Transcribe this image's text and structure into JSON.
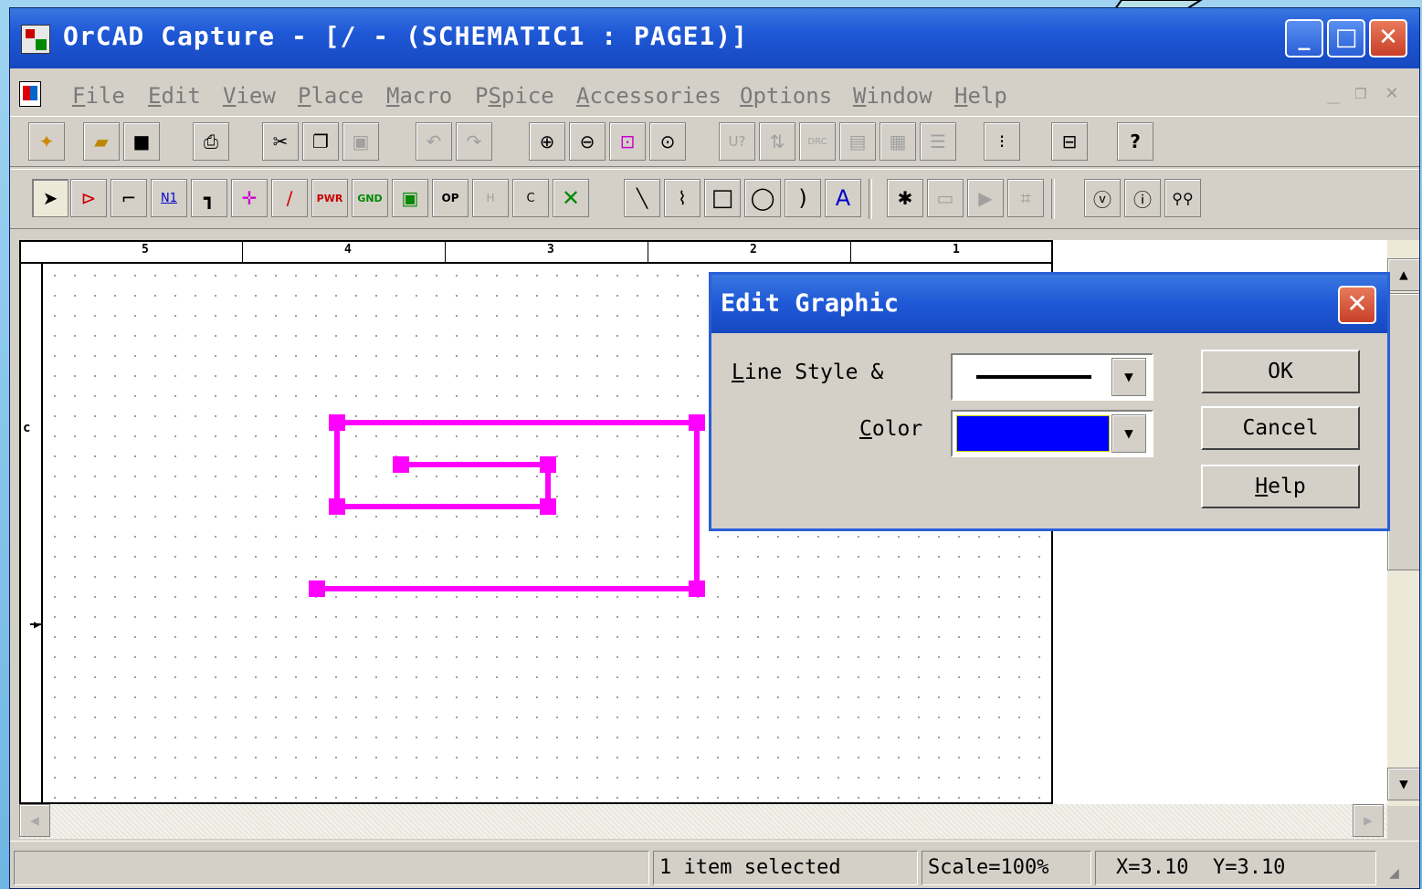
{
  "window": {
    "title": "OrCAD Capture - [/ - (SCHEMATIC1 : PAGE1)]",
    "min_glyph": "_",
    "max_glyph": "□",
    "close_glyph": "✕"
  },
  "menubar": {
    "items": [
      {
        "underline": "F",
        "rest": "ile"
      },
      {
        "underline": "E",
        "rest": "dit"
      },
      {
        "underline": "V",
        "rest": "iew"
      },
      {
        "underline": "P",
        "rest": "lace"
      },
      {
        "underline": "M",
        "rest": "acro"
      },
      {
        "pre": "P",
        "underline": "S",
        "rest": "pice"
      },
      {
        "underline": "A",
        "rest": "ccessories"
      },
      {
        "underline": "O",
        "rest": "ptions"
      },
      {
        "underline": "W",
        "rest": "indow"
      },
      {
        "underline": "H",
        "rest": "elp"
      }
    ],
    "mdi_min": "_",
    "mdi_restore": "❐",
    "mdi_close": "✕"
  },
  "toolbar1": {
    "buttons": [
      "new-icon",
      "open-icon",
      "save-icon",
      "print-icon",
      "cut-icon",
      "copy-icon",
      "paste-icon",
      "undo-icon",
      "redo-icon",
      "zoom-in-icon",
      "zoom-out-icon",
      "zoom-area-icon",
      "zoom-all-icon",
      "annotate-icon",
      "back-annotate-icon",
      "drc-icon",
      "netlist-icon",
      "cross-ref-icon",
      "bom-icon",
      "snap-grid-icon",
      "project-manager-icon",
      "help-icon"
    ],
    "labels": {
      "annotate": "U?",
      "drc": "DRC",
      "help": "?"
    }
  },
  "toolbar2": {
    "labels": {
      "net_alias": "N1",
      "power": "PWR",
      "ground": "GND",
      "off_page": "OP",
      "hier_pin": "H",
      "bus_entry": "C",
      "text": "A"
    }
  },
  "ruler": {
    "labels": [
      "5",
      "4",
      "3",
      "2",
      "1"
    ]
  },
  "canvas": {
    "border_letter": "c",
    "shape_color": "#ff00ff"
  },
  "statusbar": {
    "message": "1 item selected",
    "scale": "Scale=100%",
    "coords": "X=3.10  Y=3.10"
  },
  "dialog": {
    "title": "Edit Graphic",
    "line_style_label": {
      "underline": "L",
      "rest": "ine Style &"
    },
    "color_label": {
      "underline": "C",
      "rest": "olor"
    },
    "color_value": "#0000ff",
    "ok": "OK",
    "cancel": "Cancel",
    "help": {
      "underline": "H",
      "rest": "elp"
    }
  }
}
